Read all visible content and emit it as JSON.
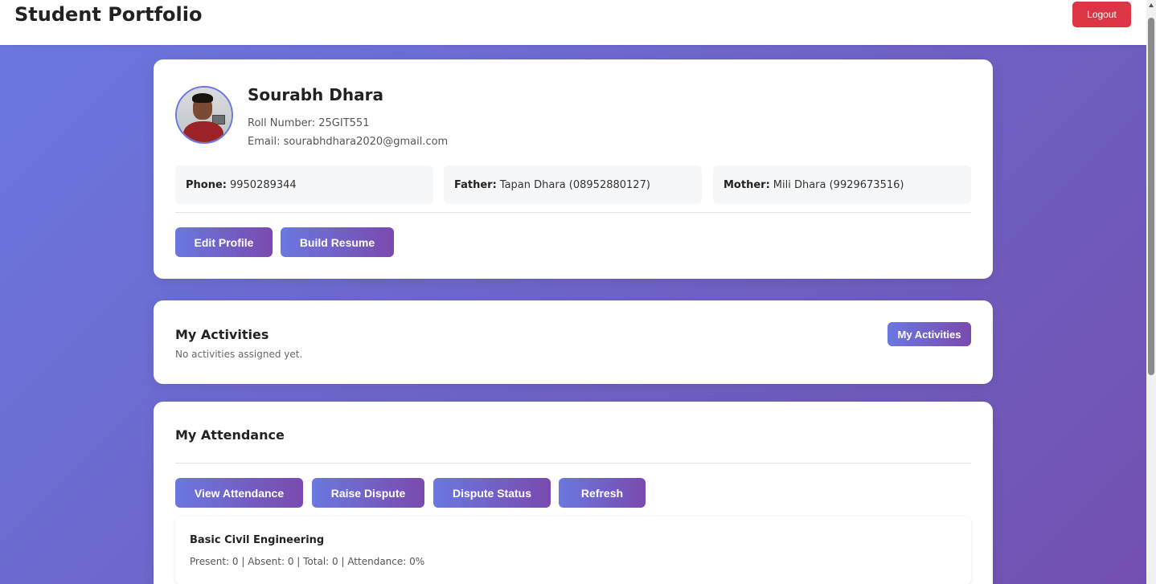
{
  "header": {
    "title": "Student Portfolio",
    "logout_label": "Logout"
  },
  "profile": {
    "name": "Sourabh Dhara",
    "roll": "Roll Number: 25GIT551",
    "email": "Email: sourabhdhara2020@gmail.com",
    "phone_label": "Phone:",
    "phone_value": "9950289344",
    "father_label": "Father:",
    "father_value": "Tapan Dhara (08952880127)",
    "mother_label": "Mother:",
    "mother_value": "Mili Dhara (9929673516)",
    "edit_label": "Edit Profile",
    "resume_label": "Build Resume"
  },
  "activities": {
    "title": "My Activities",
    "empty": "No activities assigned yet.",
    "button_label": "My Activities"
  },
  "attendance": {
    "title": "My Attendance",
    "buttons": [
      "View Attendance",
      "Raise Dispute",
      "Dispute Status",
      "Refresh"
    ],
    "subjects": [
      {
        "name": "Basic Civil Engineering",
        "stats": "Present: 0 | Absent: 0 | Total: 0 | Attendance: 0%"
      }
    ]
  },
  "colors": {
    "accent_start": "#6a78e0",
    "accent_end": "#7a4aae",
    "logout": "#dc3545"
  }
}
